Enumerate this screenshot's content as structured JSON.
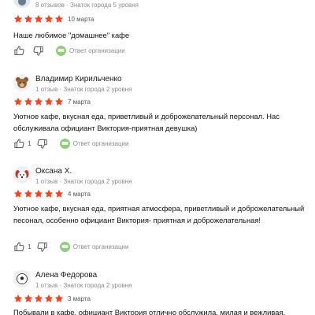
{
  "colors": {
    "star": "#fc3f1d",
    "text": "#111111",
    "meta": "#8a8a8a",
    "reply_badge": "#8fcf7b"
  },
  "reviews": [
    {
      "name": "",
      "meta": "8 отзывов · Знаток города 5 уровня",
      "rating": 5,
      "date": "10 марта",
      "text": "Наше любимое \"домашнее\" кафе",
      "likes": "",
      "dislikes": "",
      "reply_label": "Ответ организации",
      "avatar_icon": "user-avatar-icon"
    },
    {
      "name": "Владимир Кирильченко",
      "meta": "1 отзыв · Знаток города 2 уровня",
      "rating": 5,
      "date": "7 марта",
      "text": "Уютное кафе, вкусная еда, приветливый и доброжелательный персонал. Нас обслуживала официант Виктория-приятная девушка)",
      "likes": "1",
      "dislikes": "",
      "reply_label": "Ответ организации",
      "avatar_icon": "bear-avatar-icon"
    },
    {
      "name": "Оксана Х.",
      "meta": "1 отзыв · Знаток города 2 уровня",
      "rating": 5,
      "date": "4 марта",
      "text": "Уютное кафе, вкусная еда, приятная атмосфера, приветливый и доброжелательный песонал, особенно официант Виктория- приятная и доброжелательная!",
      "likes": "1",
      "dislikes": "",
      "reply_label": "Ответ организации",
      "avatar_icon": "dog-avatar-icon"
    },
    {
      "name": "Алена Федорова",
      "meta": "1 отзыв · Знаток города 2 уровня",
      "rating": 5,
      "date": "3 марта",
      "text": "Побывали в кафе, официант Виктория отлично обслужила, милая и вежливая.",
      "likes": "",
      "dislikes": "",
      "reply_label": "",
      "avatar_icon": "soccer-ball-avatar-icon"
    }
  ]
}
